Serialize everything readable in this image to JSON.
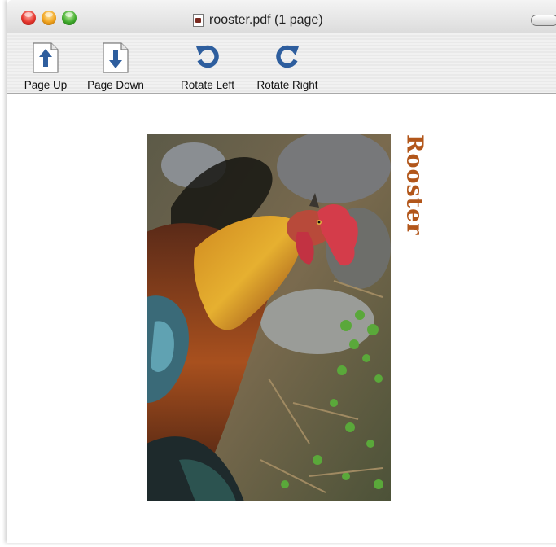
{
  "window": {
    "title": "rooster.pdf (1 page)"
  },
  "toolbar": {
    "page_up": "Page Up",
    "page_down": "Page Down",
    "rotate_left": "Rotate Left",
    "rotate_right": "Rotate Right"
  },
  "document": {
    "caption": "Rooster"
  },
  "colors": {
    "caption": "#b2561a",
    "icon_blue": "#2e5e9e"
  }
}
